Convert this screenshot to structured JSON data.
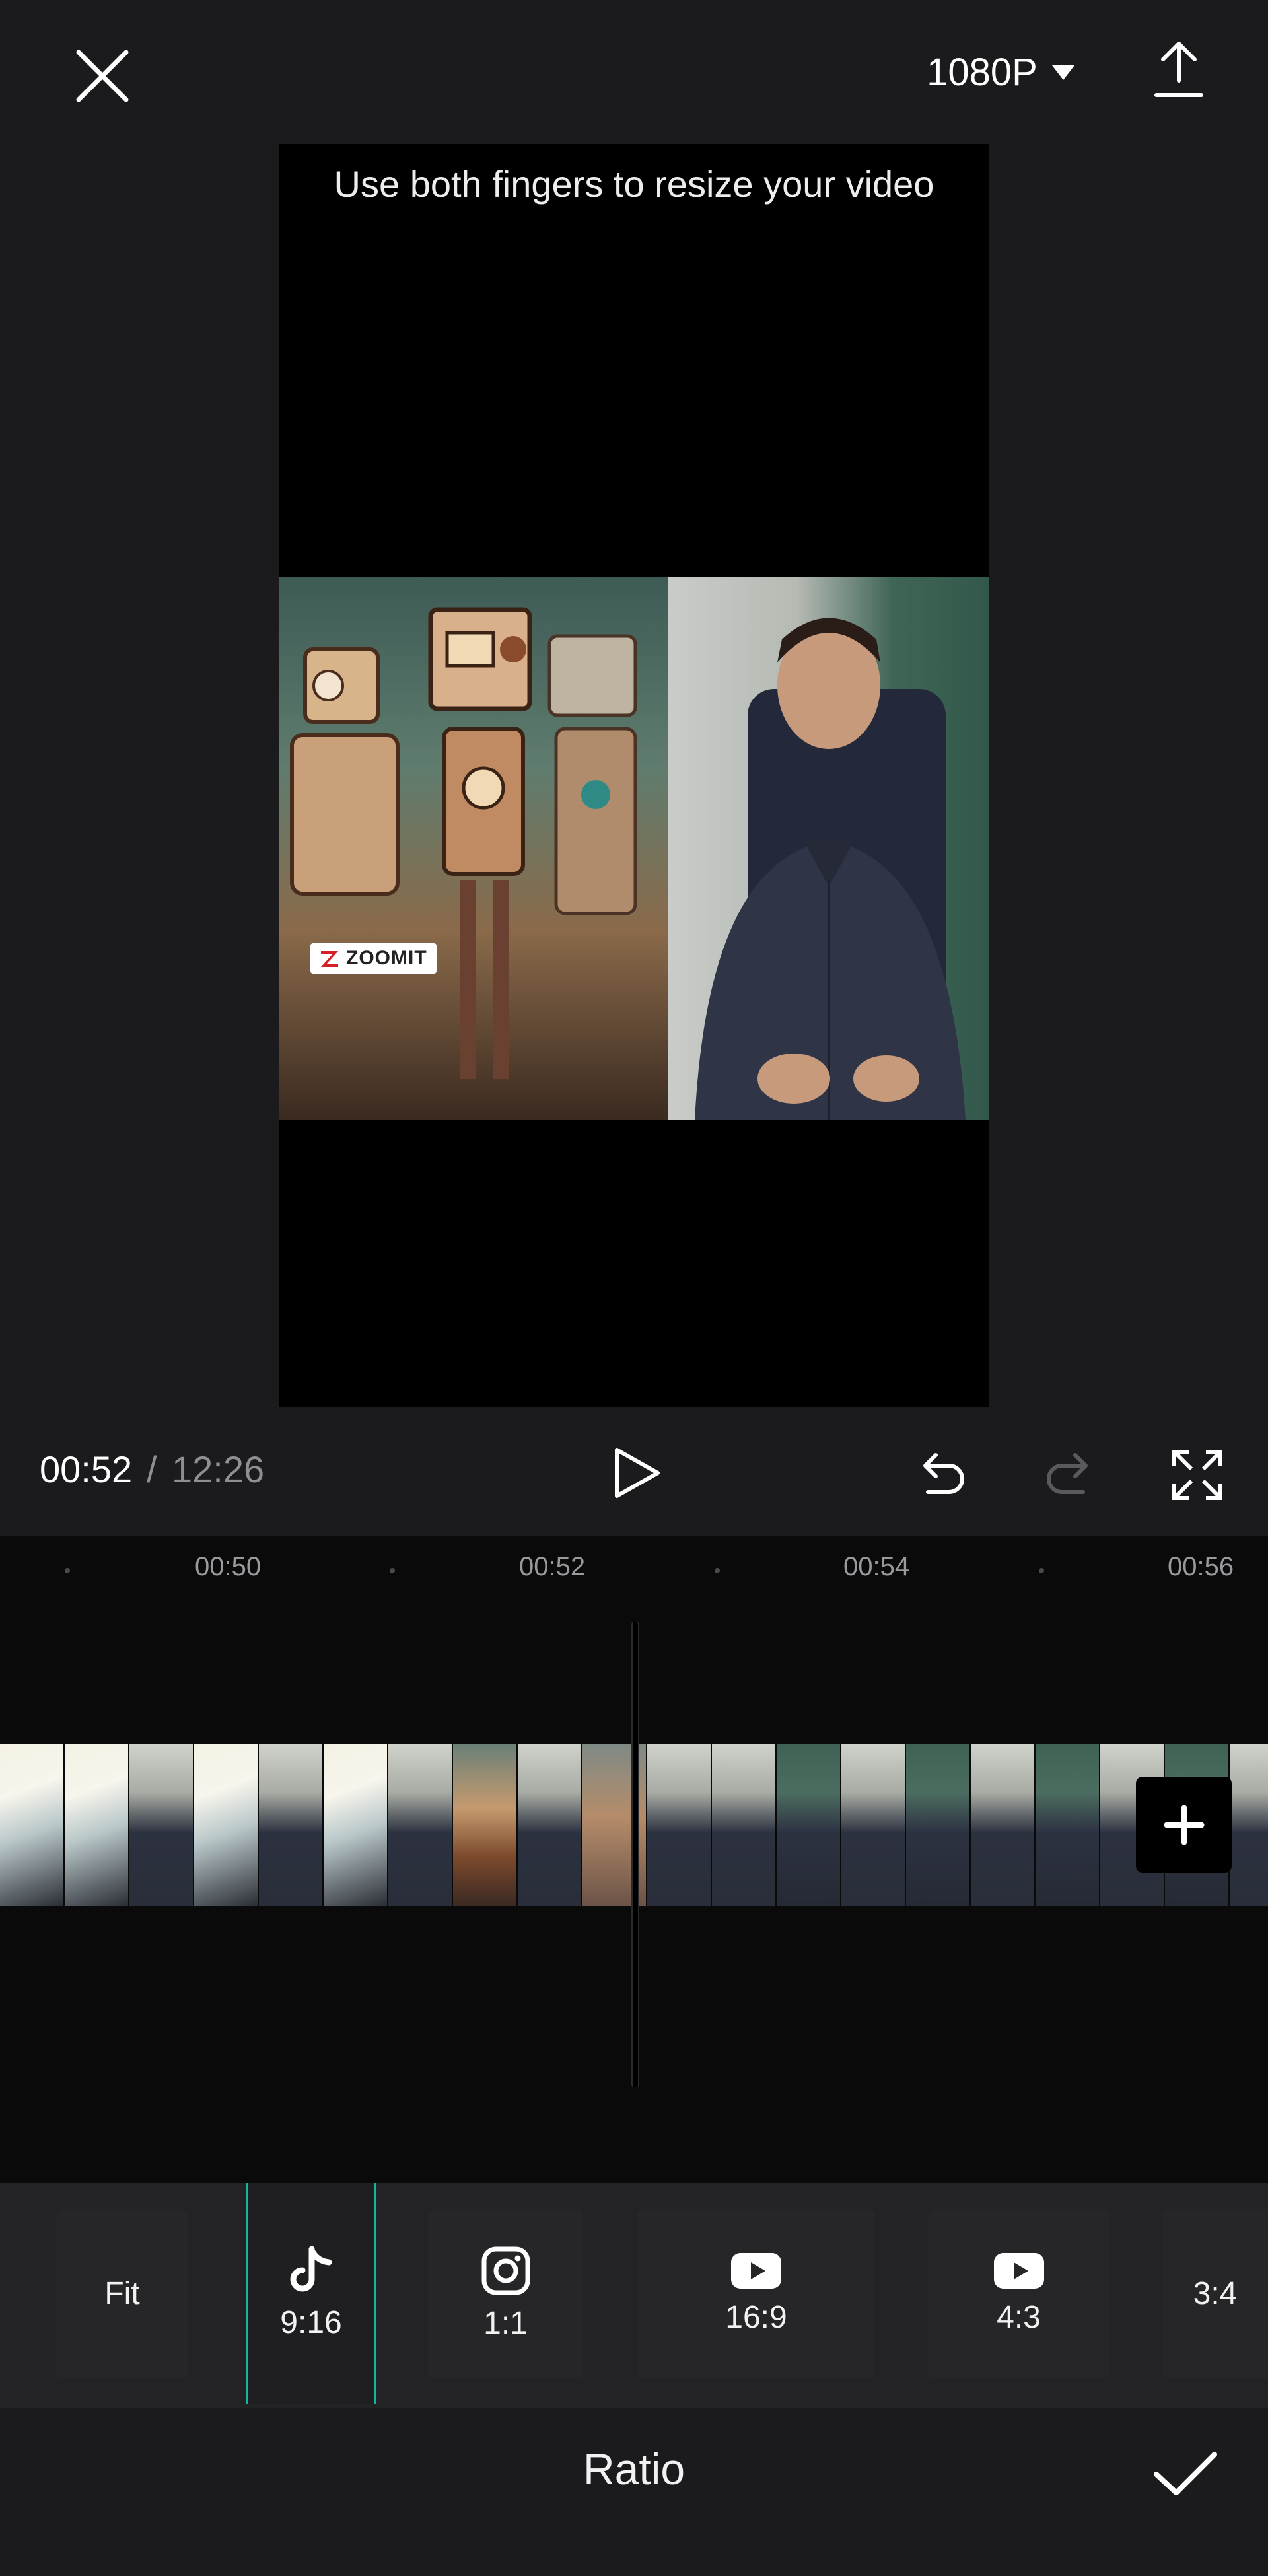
{
  "header": {
    "close_icon": "close-icon",
    "resolution": "1080P",
    "resolution_icon": "caret-down-icon",
    "export_icon": "export-upload-icon"
  },
  "preview": {
    "hint": "Use both fingers to resize your video",
    "watermark": "ZOOMIT"
  },
  "playback": {
    "current_time": "00:52",
    "separator": "/",
    "total_time": "12:26",
    "icons": [
      "play-icon",
      "undo-icon",
      "redo-icon",
      "fullscreen-icon"
    ]
  },
  "timeline": {
    "ruler": [
      "00:50",
      "00:52",
      "00:54",
      "00:56"
    ],
    "add_clip_icon": "plus-icon"
  },
  "ratios": {
    "items": [
      {
        "label": "Fit",
        "icon": ""
      },
      {
        "label": "9:16",
        "icon": "tiktok-icon"
      },
      {
        "label": "1:1",
        "icon": "instagram-icon"
      },
      {
        "label": "16:9",
        "icon": "youtube-icon"
      },
      {
        "label": "4:3",
        "icon": "youtube-icon"
      },
      {
        "label": "3:4",
        "icon": ""
      }
    ],
    "selected": "9:16"
  },
  "footer": {
    "title": "Ratio",
    "confirm_icon": "checkmark-icon"
  },
  "colors": {
    "background": "#1b1b1d",
    "accent": "#17b5a0",
    "muted_text": "#8e8e93"
  }
}
